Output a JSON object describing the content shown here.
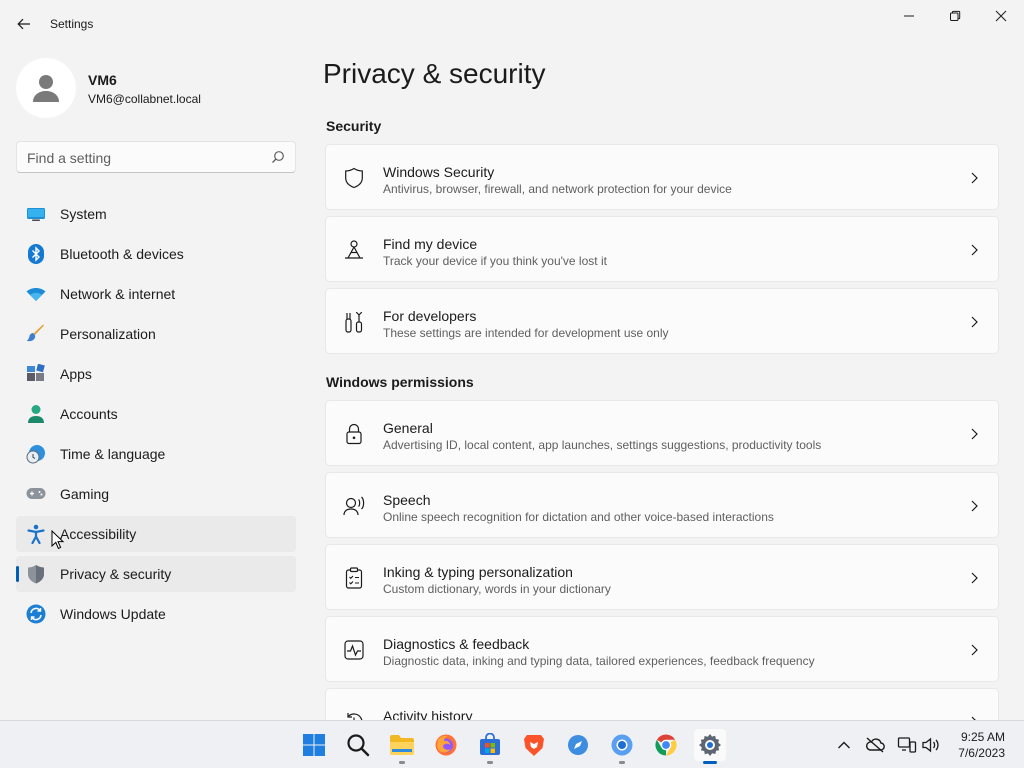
{
  "window": {
    "title": "Settings",
    "controls": [
      "minimize",
      "restore",
      "close"
    ]
  },
  "user": {
    "name": "VM6",
    "email": "VM6@collabnet.local"
  },
  "search": {
    "placeholder": "Find a setting",
    "value": ""
  },
  "sidebar": {
    "items": [
      {
        "label": "System",
        "icon": "monitor-icon",
        "state": "normal"
      },
      {
        "label": "Bluetooth & devices",
        "icon": "bluetooth-icon",
        "state": "normal"
      },
      {
        "label": "Network & internet",
        "icon": "wifi-icon",
        "state": "normal"
      },
      {
        "label": "Personalization",
        "icon": "paintbrush-icon",
        "state": "normal"
      },
      {
        "label": "Apps",
        "icon": "apps-icon",
        "state": "normal"
      },
      {
        "label": "Accounts",
        "icon": "person-icon",
        "state": "normal"
      },
      {
        "label": "Time & language",
        "icon": "clock-globe-icon",
        "state": "normal"
      },
      {
        "label": "Gaming",
        "icon": "gamepad-icon",
        "state": "normal"
      },
      {
        "label": "Accessibility",
        "icon": "accessibility-icon",
        "state": "hover"
      },
      {
        "label": "Privacy & security",
        "icon": "shield-icon",
        "state": "selected"
      },
      {
        "label": "Windows Update",
        "icon": "update-icon",
        "state": "normal"
      }
    ]
  },
  "main": {
    "page_title": "Privacy & security",
    "sections": [
      {
        "title": "Security",
        "cards": [
          {
            "title": "Windows Security",
            "description": "Antivirus, browser, firewall, and network protection for your device",
            "icon": "shield-outline-icon"
          },
          {
            "title": "Find my device",
            "description": "Track your device if you think you've lost it",
            "icon": "find-device-icon"
          },
          {
            "title": "For developers",
            "description": "These settings are intended for development use only",
            "icon": "developer-tools-icon"
          }
        ]
      },
      {
        "title": "Windows permissions",
        "cards": [
          {
            "title": "General",
            "description": "Advertising ID, local content, app launches, settings suggestions, productivity tools",
            "icon": "lock-icon"
          },
          {
            "title": "Speech",
            "description": "Online speech recognition for dictation and other voice-based interactions",
            "icon": "speech-icon"
          },
          {
            "title": "Inking & typing personalization",
            "description": "Custom dictionary, words in your dictionary",
            "icon": "clipboard-checklist-icon"
          },
          {
            "title": "Diagnostics & feedback",
            "description": "Diagnostic data, inking and typing data, tailored experiences, feedback frequency",
            "icon": "diagnostics-icon"
          },
          {
            "title": "Activity history",
            "description": "",
            "icon": "history-icon"
          }
        ]
      }
    ]
  },
  "taskbar": {
    "apps": [
      {
        "name": "start",
        "icon": "windows-logo-icon",
        "running": false
      },
      {
        "name": "search",
        "icon": "search-icon",
        "running": false
      },
      {
        "name": "file-explorer",
        "icon": "folder-icon",
        "running": true
      },
      {
        "name": "firefox",
        "icon": "firefox-icon",
        "running": false
      },
      {
        "name": "microsoft-store",
        "icon": "store-icon",
        "running": true
      },
      {
        "name": "brave",
        "icon": "brave-icon",
        "running": false
      },
      {
        "name": "browser-compass",
        "icon": "compass-icon",
        "running": false
      },
      {
        "name": "chromium",
        "icon": "chromium-icon",
        "running": true
      },
      {
        "name": "chrome",
        "icon": "chrome-icon",
        "running": false
      },
      {
        "name": "settings",
        "icon": "gear-icon",
        "running": true,
        "active": true
      }
    ],
    "tray": {
      "icons": [
        "chevron-up-icon",
        "onedrive-offline-icon",
        "network-icon",
        "volume-icon"
      ],
      "time": "9:25 AM",
      "date": "7/6/2023"
    }
  },
  "colors": {
    "accent": "#005fb8",
    "background": "#f3f3f3",
    "card": "#fbfbfb"
  }
}
